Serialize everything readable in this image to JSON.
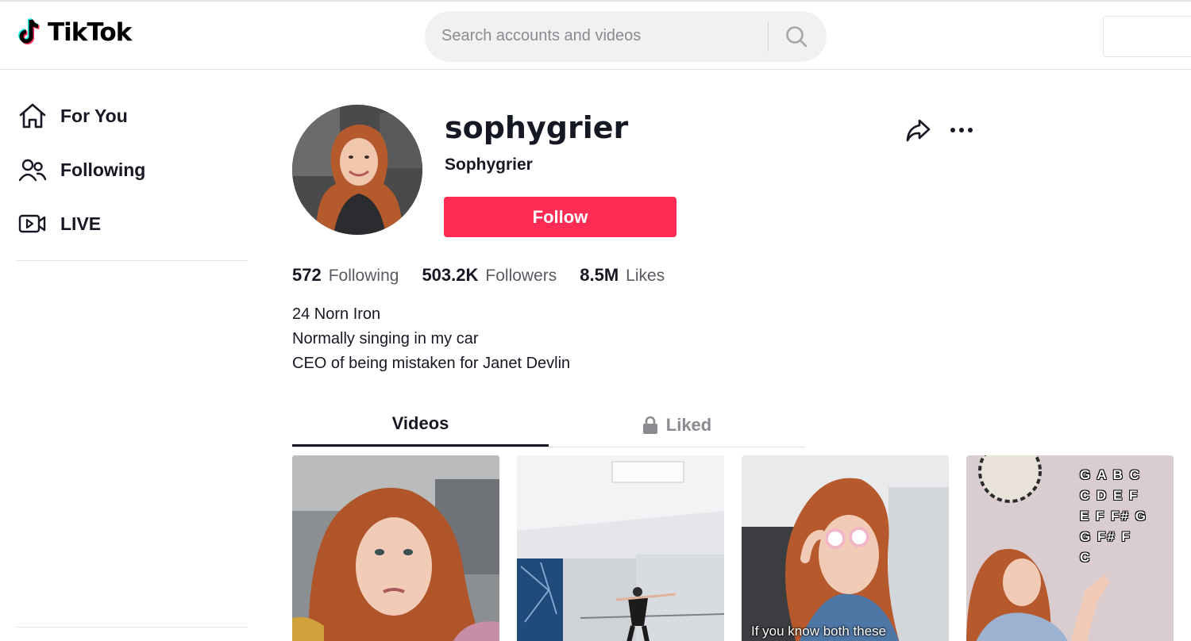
{
  "app": {
    "name": "TikTok"
  },
  "header": {
    "search_placeholder": "Search accounts and videos"
  },
  "sidebar": {
    "items": [
      {
        "label": "For You",
        "icon": "home-icon"
      },
      {
        "label": "Following",
        "icon": "people-icon"
      },
      {
        "label": "LIVE",
        "icon": "live-video-icon"
      }
    ]
  },
  "profile": {
    "username": "sophygrier",
    "nickname": "Sophygrier",
    "follow_label": "Follow",
    "stats": [
      {
        "value": "572",
        "label": "Following"
      },
      {
        "value": "503.2K",
        "label": "Followers"
      },
      {
        "value": "8.5M",
        "label": "Likes"
      }
    ],
    "bio": [
      "24 Norn Iron",
      "Normally singing in my car",
      "CEO of being mistaken for Janet Devlin"
    ]
  },
  "tabs": [
    {
      "label": "Videos",
      "active": true
    },
    {
      "label": "Liked",
      "active": false,
      "icon": "lock-icon"
    }
  ],
  "videos": [
    {
      "caption": ""
    },
    {
      "caption": ""
    },
    {
      "caption": "If you know both these"
    },
    {
      "caption": "",
      "overlay_text": "G A B C\nC D E F\nE F F# G\nG F# F\nC"
    }
  ],
  "colors": {
    "accent": "#fe2c55",
    "text": "#161823",
    "muted": "#8a8b91"
  }
}
